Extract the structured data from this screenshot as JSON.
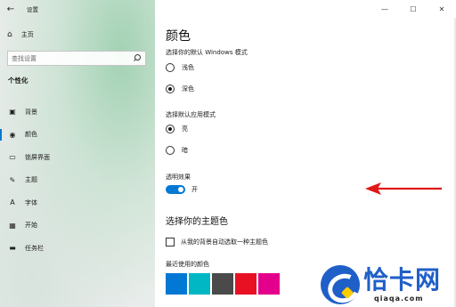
{
  "window": {
    "app_title": "设置",
    "controls": {
      "minimize": "—",
      "maximize": "☐",
      "close": "✕"
    }
  },
  "sidebar": {
    "back_icon": "←",
    "home_label": "主页",
    "home_icon": "⌂",
    "search_placeholder": "查找设置",
    "section_title": "个性化",
    "items": [
      {
        "icon": "▣",
        "label": "背景"
      },
      {
        "icon": "◉",
        "label": "颜色"
      },
      {
        "icon": "▭",
        "label": "锁屏界面"
      },
      {
        "icon": "✎",
        "label": "主题"
      },
      {
        "icon": "A",
        "label": "字体"
      },
      {
        "icon": "▦",
        "label": "开始"
      },
      {
        "icon": "▬",
        "label": "任务栏"
      }
    ]
  },
  "main": {
    "title": "颜色",
    "windows_mode_label": "选择你的默认 Windows 模式",
    "windows_mode_options": [
      {
        "label": "浅色",
        "selected": false
      },
      {
        "label": "深色",
        "selected": true
      }
    ],
    "app_mode_label": "选择默认应用模式",
    "app_mode_options": [
      {
        "label": "亮",
        "selected": true
      },
      {
        "label": "暗",
        "selected": false
      }
    ],
    "transparency_label": "透明效果",
    "transparency_state": "开",
    "accent_title": "选择你的主题色",
    "auto_pick_label": "从我的背景自动选取一种主题色",
    "recent_colors_label": "最近使用的颜色",
    "recent_colors": [
      "#0078d4",
      "#00b7c3",
      "#4a4a4a",
      "#e81123",
      "#e3008c"
    ]
  },
  "colors": {
    "accent": "#0078d4",
    "arrow": "#e01818"
  },
  "watermark": {
    "brand": "恰卡网",
    "domain": "qiaqa.com"
  }
}
